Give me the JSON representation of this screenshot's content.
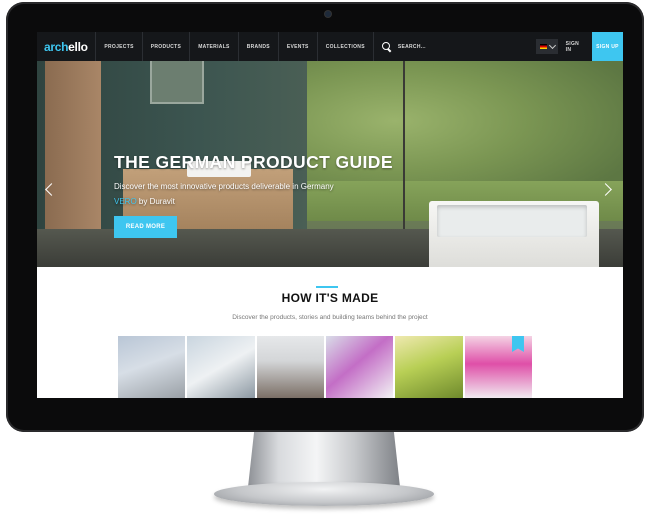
{
  "nav": {
    "logo_prefix": "arch",
    "logo_suffix": "ello",
    "items": [
      "PROJECTS",
      "PRODUCTS",
      "MATERIALS",
      "BRANDS",
      "EVENTS",
      "COLLECTIONS"
    ],
    "search_label": "SEARCH...",
    "sign_in": "SIGN IN",
    "sign_up": "SIGN UP"
  },
  "hero": {
    "title": "THE GERMAN PRODUCT GUIDE",
    "subtitle": "Discover the most innovative products deliverable in Germany",
    "credit_brand": "VERO",
    "credit_by": " by Duravit",
    "button": "READ MORE"
  },
  "section": {
    "title": "HOW IT'S MADE",
    "subtitle": "Discover the products, stories and building teams behind the project"
  },
  "colors": {
    "accent": "#3ec6f0",
    "nav_bg": "#15171a"
  },
  "icons": [
    "search-icon",
    "flag-icon",
    "chevron-down-icon",
    "arrow-left-icon",
    "arrow-right-icon",
    "ribbon-badge-icon",
    "camera-icon"
  ]
}
